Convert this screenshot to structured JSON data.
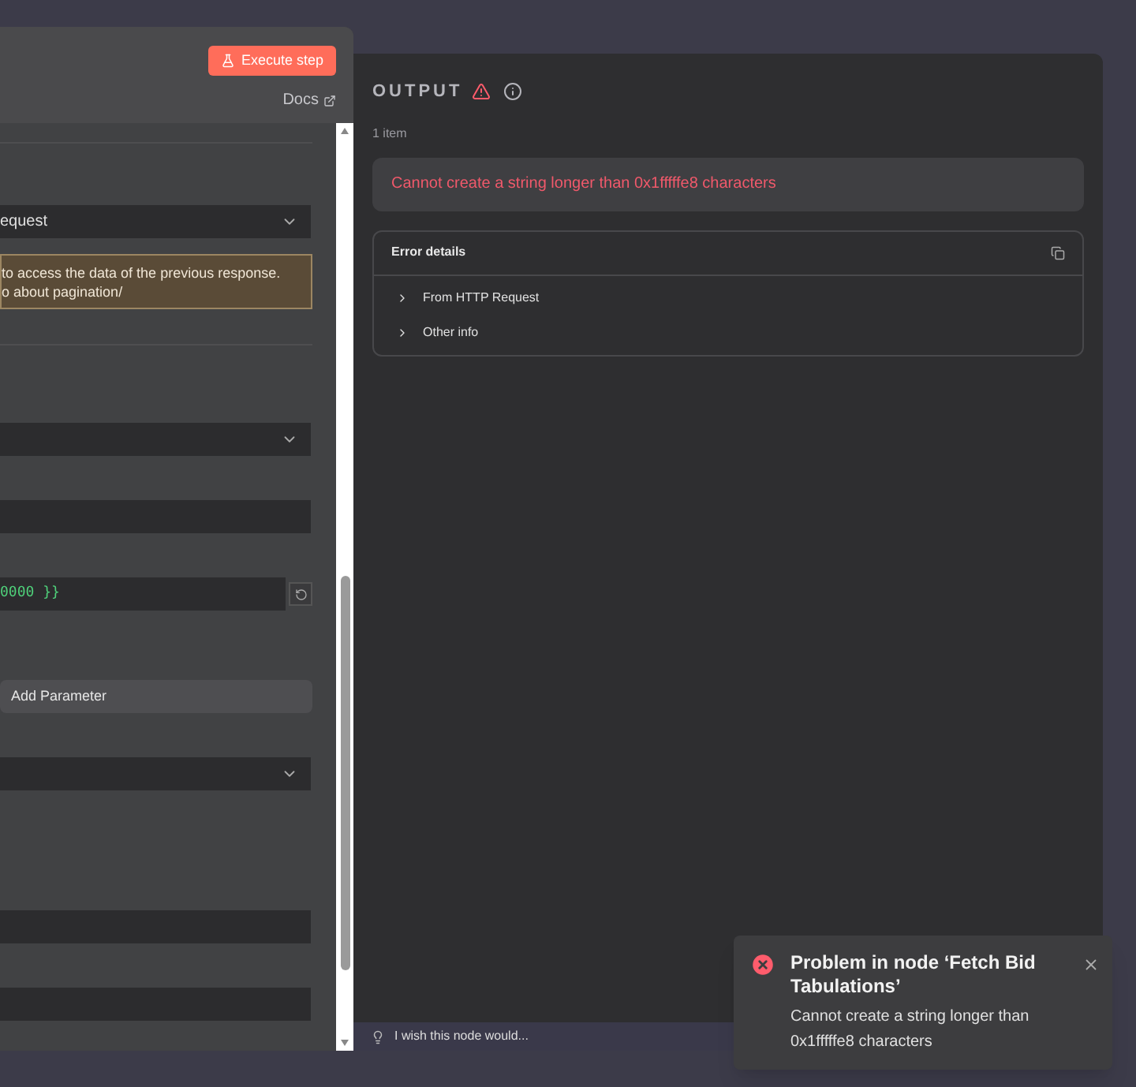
{
  "header": {
    "execute_button": "Execute step",
    "docs_link": "Docs"
  },
  "fields": [
    {
      "kind": "select",
      "value": "equest"
    },
    {
      "kind": "notice",
      "lines": [
        "to access the data of the previous response.",
        "o about pagination/"
      ]
    },
    {
      "kind": "select"
    },
    {
      "kind": "input"
    },
    {
      "kind": "code",
      "value": "0000 }}"
    },
    {
      "kind": "button",
      "value": "Add Parameter"
    },
    {
      "kind": "select"
    },
    {
      "kind": "input"
    },
    {
      "kind": "input"
    }
  ],
  "output": {
    "title": "OUTPUT",
    "count": "1 item",
    "error_message": "Cannot create a string longer than 0x1fffffe8 characters",
    "details": {
      "title": "Error details",
      "items": [
        {
          "label": "From HTTP Request",
          "expanded": false
        },
        {
          "label": "Other info",
          "expanded": false
        }
      ]
    },
    "feedback": "I wish this node would..."
  },
  "toast": {
    "title": "Problem in node ‘Fetch Bid Tabulations’",
    "message": "Cannot create a string longer than 0x1fffffe8 characters"
  }
}
